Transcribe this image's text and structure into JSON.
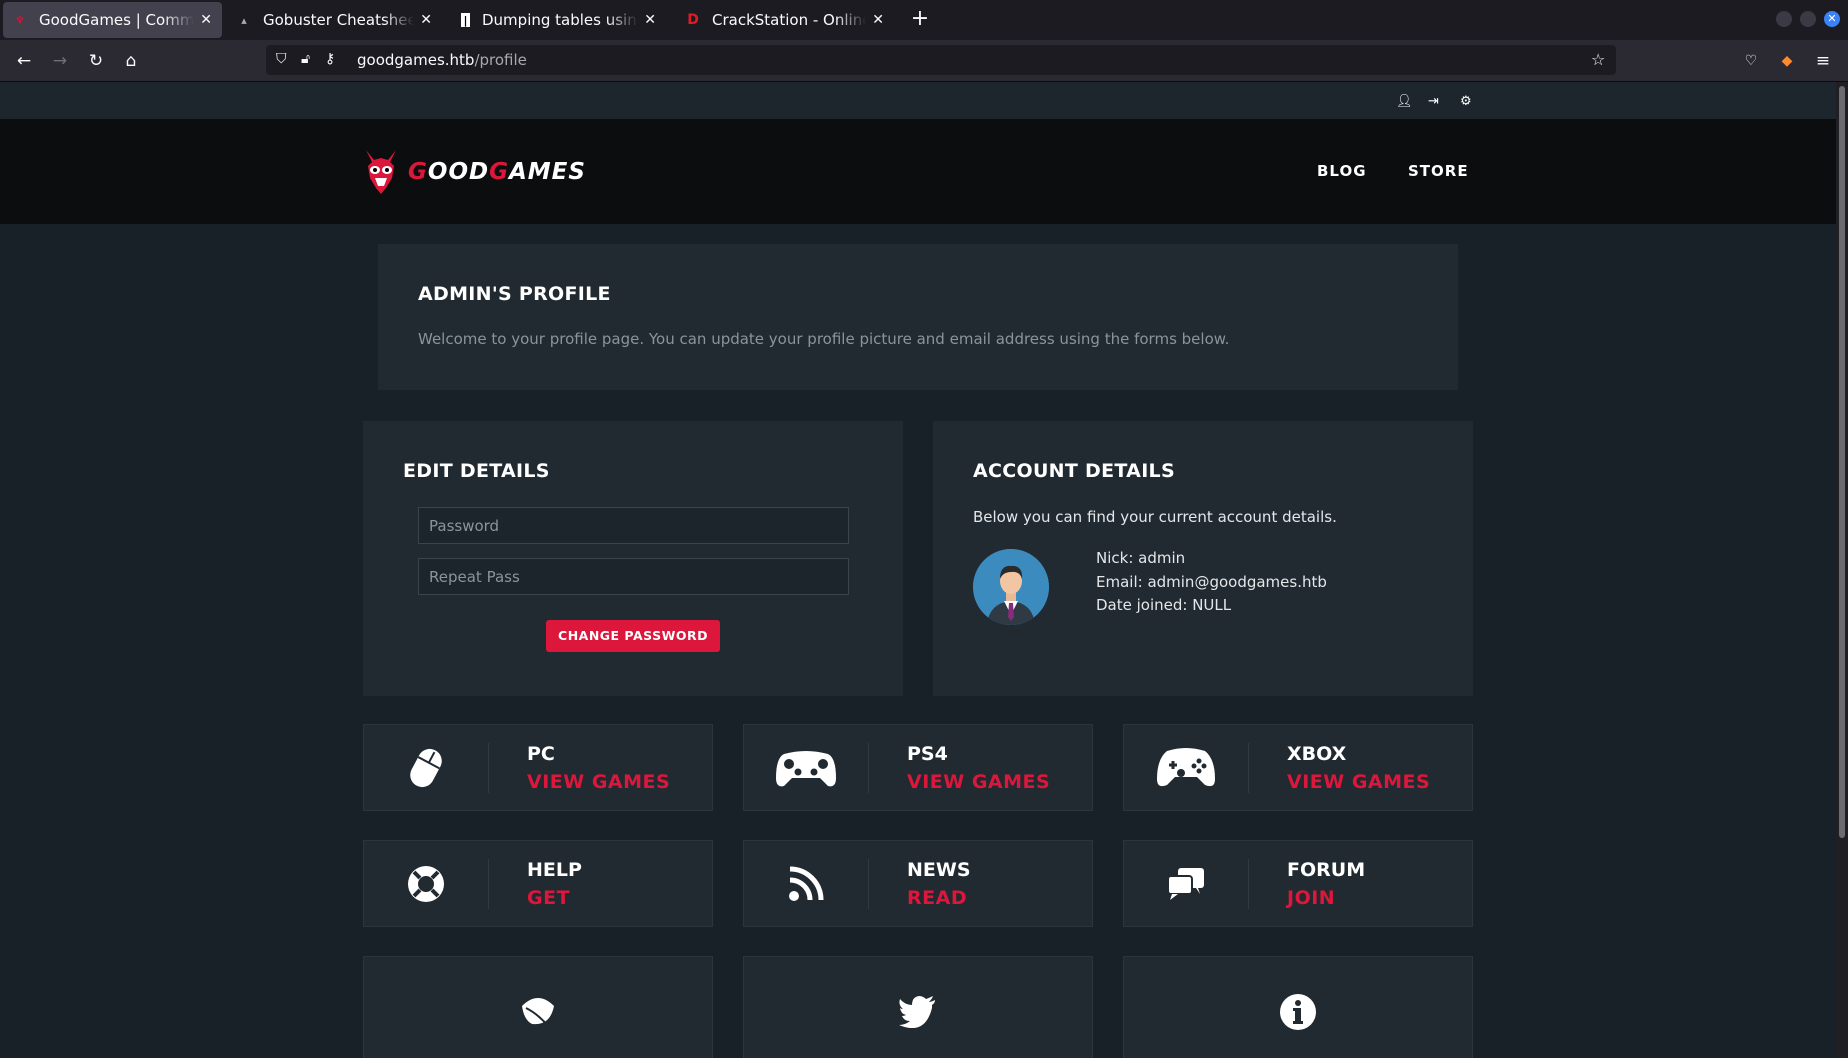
{
  "browser": {
    "tabs": [
      {
        "title": "GoodGames | Community",
        "active": true
      },
      {
        "title": "Gobuster Cheatsheet – Gi",
        "active": false
      },
      {
        "title": "Dumping tables using sql",
        "active": false
      },
      {
        "title": "CrackStation - Online Pas",
        "active": false
      }
    ],
    "url_host": "goodgames.htb",
    "url_path": "/profile"
  },
  "site": {
    "logo_prefix": "G",
    "logo_mid": "OOD",
    "logo_g": "G",
    "logo_suffix": "AMES",
    "menu": [
      "BLOG",
      "STORE"
    ],
    "accent": "#dd163b"
  },
  "profile": {
    "title": "ADMIN'S PROFILE",
    "intro": "Welcome to your profile page. You can update your profile picture and email address using the forms below."
  },
  "edit": {
    "title": "EDIT DETAILS",
    "password_placeholder": "Password",
    "repeat_placeholder": "Repeat Pass",
    "button": "CHANGE PASSWORD"
  },
  "account": {
    "title": "ACCOUNT DETAILS",
    "subtitle": "Below you can find your current account details.",
    "nick": "Nick: admin",
    "email": "Email: admin@goodgames.htb",
    "joined": "Date joined: NULL"
  },
  "tiles": [
    {
      "label": "PC",
      "action": "VIEW GAMES",
      "icon": "mouse-icon"
    },
    {
      "label": "PS4",
      "action": "VIEW GAMES",
      "icon": "ps4-controller-icon"
    },
    {
      "label": "XBOX",
      "action": "VIEW GAMES",
      "icon": "xbox-controller-icon"
    },
    {
      "label": "HELP",
      "action": "GET",
      "icon": "lifebuoy-icon"
    },
    {
      "label": "NEWS",
      "action": "READ",
      "icon": "rss-icon"
    },
    {
      "label": "FORUM",
      "action": "JOIN",
      "icon": "chat-bubbles-icon"
    }
  ],
  "bottom_tiles": [
    {
      "icon": "leaf-icon"
    },
    {
      "icon": "twitter-icon"
    },
    {
      "icon": "info-icon"
    }
  ]
}
